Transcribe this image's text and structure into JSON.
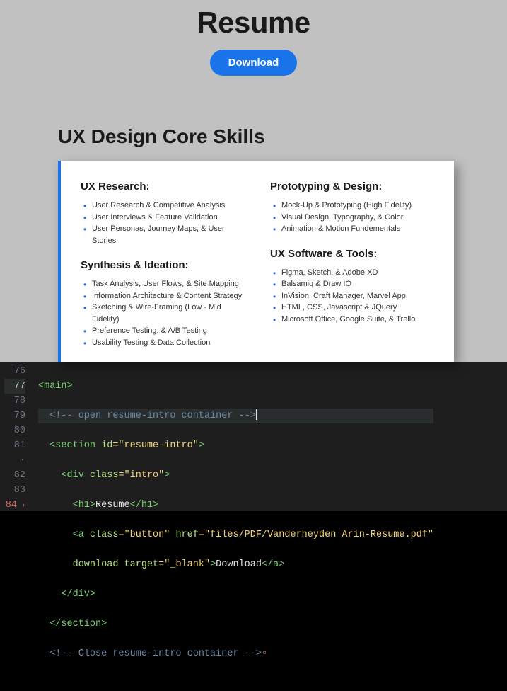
{
  "intro": {
    "title": "Resume",
    "download_label": "Download"
  },
  "section": {
    "title": "UX Design Core Skills"
  },
  "left": {
    "h1": "UX Research:",
    "items1": [
      "User Research & Competitive Analysis",
      "User Interviews & Feature Validation",
      "User Personas, Journey Maps, & User Stories"
    ],
    "h2": "Synthesis & Ideation:",
    "items2": [
      "Task Analysis, User Flows, & Site Mapping",
      "Information Architecture & Content Strategy",
      "Sketching & Wire-Framing (Low - Mid Fidelity)",
      "Preference Testing, & A/B Testing",
      "Usability Testing & Data Collection"
    ]
  },
  "right": {
    "h1": "Prototyping & Design:",
    "items1": [
      "Mock-Up & Prototyping (High Fidelity)",
      "Visual Design, Typography, & Color",
      "Animation & Motion Fundementals"
    ],
    "h2": "UX Software & Tools:",
    "items2": [
      "Figma, Sketch, & Adobe XD",
      "Balsamiq & Draw IO",
      "InVision, Craft Manager, Marvel App",
      "HTML, CSS, Javascript & JQuery",
      "Microsoft Office, Google Suite, & Trello"
    ]
  },
  "editor": {
    "lines": [
      "76",
      "77",
      "78",
      "79",
      "80",
      "81",
      "·",
      "82",
      "83",
      "84"
    ],
    "l76": "<main>",
    "l77": "  <!-- open resume-intro container -->",
    "l78_a": "  <section ",
    "l78_b": "id",
    "l78_c": "=\"resume-intro\"",
    "l78_d": ">",
    "l79_a": "    <div ",
    "l79_b": "class",
    "l79_c": "=\"intro\"",
    "l79_d": ">",
    "l80_a": "      <h1>",
    "l80_b": "Resume",
    "l80_c": "</h1>",
    "l81_a": "      <a ",
    "l81_b": "class",
    "l81_c": "=\"button\" ",
    "l81_d": "href",
    "l81_e": "=\"files/PDF/Vanderheyden Arin-Resume.pdf\"",
    "l81x_a": "      ",
    "l81x_b": "download target",
    "l81x_c": "=\"_blank\"",
    "l81x_d": ">",
    "l81x_e": "Download",
    "l81x_f": "</a>",
    "l82": "    </div>",
    "l83": "  </section>",
    "l84": "  <!-- Close resume-intro container -->"
  }
}
